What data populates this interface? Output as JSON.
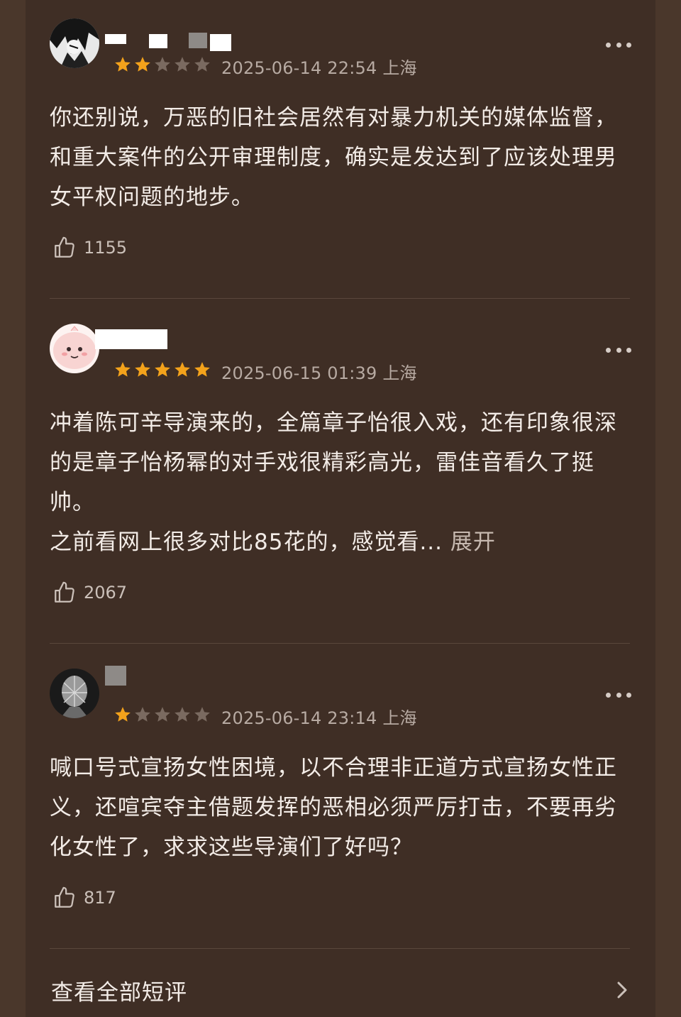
{
  "colors": {
    "background": "#4a372b",
    "panel": "#3f2e25",
    "star_filled": "#f3a21b",
    "star_empty": "#7a6a60",
    "text": "#f3ece7",
    "muted": "#b7aaa2"
  },
  "reviews": [
    {
      "rating": 2,
      "date": "2025-06-14 22:54",
      "location": "上海",
      "text": "你还别说，万恶的旧社会居然有对暴力机关的媒体监督，和重大案件的公开审理制度，确实是发达到了应该处理男女平权问题的地步。",
      "likes": "1155",
      "avatar_icon": "anime-avatar-icon"
    },
    {
      "rating": 5,
      "date": "2025-06-15 01:39",
      "location": "上海",
      "text": "冲着陈可辛导演来的，全篇章子怡很入戏，还有印象很深的是章子怡杨幂的对手戏很精彩高光，雷佳音看久了挺帅。",
      "text_line2": "之前看网上很多对比85花的，感觉看...",
      "expand_label": "展开",
      "likes": "2067",
      "avatar_icon": "pink-cartoon-avatar-icon"
    },
    {
      "rating": 1,
      "date": "2025-06-14 23:14",
      "location": "上海",
      "text": "喊口号式宣扬女性困境，以不合理非正道方式宣扬女性正义，还喧宾夺主借题发挥的恶相必须严厉打击，不要再劣化女性了，求求这些导演们了好吗？",
      "likes": "817",
      "avatar_icon": "sculpture-avatar-icon"
    }
  ],
  "footer": {
    "see_all_label": "查看全部短评",
    "chevron_icon": "chevron-right-icon"
  }
}
